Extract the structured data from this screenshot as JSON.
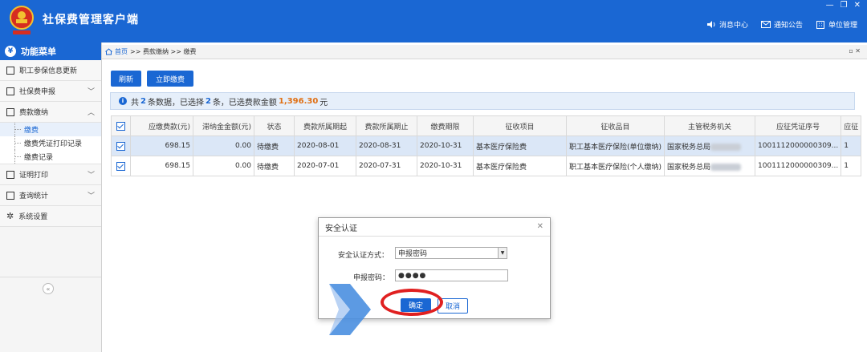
{
  "header": {
    "app_title": "社保费管理客户端",
    "links": [
      {
        "icon": "speaker-icon",
        "label": "消息中心"
      },
      {
        "icon": "mail-icon",
        "label": "通知公告"
      },
      {
        "icon": "building-icon",
        "label": "单位管理"
      }
    ]
  },
  "sidebar": {
    "title": "功能菜单",
    "items": [
      {
        "label": "职工参保信息更新",
        "icon": "id-card-icon",
        "chevron": ""
      },
      {
        "label": "社保费申报",
        "icon": "form-icon",
        "chevron": "﹀"
      },
      {
        "label": "费款缴纳",
        "icon": "payment-icon",
        "chevron": "︿"
      },
      {
        "label": "证明打印",
        "icon": "print-icon",
        "chevron": "﹀"
      },
      {
        "label": "查询统计",
        "icon": "chart-icon",
        "chevron": "﹀"
      },
      {
        "label": "系统设置",
        "icon": "gear-icon",
        "chevron": ""
      }
    ],
    "subitems": [
      "缴费",
      "缴费凭证打印记录",
      "缴费记录"
    ],
    "collapse": "«"
  },
  "breadcrumb": {
    "home": "首页",
    "path": ">> 费款缴纳 >> 缴费"
  },
  "toolbar": {
    "refresh": "刷新",
    "pay_now": "立即缴费"
  },
  "summary": {
    "prefix": "共",
    "count": "2",
    "mid": "条数据，已选择",
    "selected": "2",
    "mid2": "条，已选费款金额",
    "amount": "1,396.30",
    "suffix": "元"
  },
  "table": {
    "columns": [
      "应缴费款(元)",
      "滞纳金金额(元)",
      "状态",
      "费款所属期起",
      "费款所属期止",
      "缴费期限",
      "征收项目",
      "征收品目",
      "主管税务机关",
      "应征凭证序号",
      "应征"
    ],
    "rows": [
      {
        "amount": "698.15",
        "late_fee": "0.00",
        "status": "待缴费",
        "start": "2020-08-01",
        "end": "2020-08-31",
        "deadline": "2020-10-31",
        "item": "基本医疗保险费",
        "sub_item": "职工基本医疗保险(单位缴纳)",
        "authority": "国家税务总局",
        "voucher": "1001112000000309...",
        "extra": "1"
      },
      {
        "amount": "698.15",
        "late_fee": "0.00",
        "status": "待缴费",
        "start": "2020-07-01",
        "end": "2020-07-31",
        "deadline": "2020-10-31",
        "item": "基本医疗保险费",
        "sub_item": "职工基本医疗保险(个人缴纳)",
        "authority": "国家税务总局",
        "voucher": "1001112000000309...",
        "extra": "1"
      }
    ]
  },
  "dialog": {
    "title": "安全认证",
    "method_label": "安全认证方式：",
    "method_value": "申报密码",
    "password_label": "申报密码：",
    "password_value": "●●●●",
    "ok": "确定",
    "cancel": "取消"
  },
  "colors": {
    "brand": "#1a67d3",
    "amount": "#e07014",
    "highlight_ring": "#e02020"
  }
}
